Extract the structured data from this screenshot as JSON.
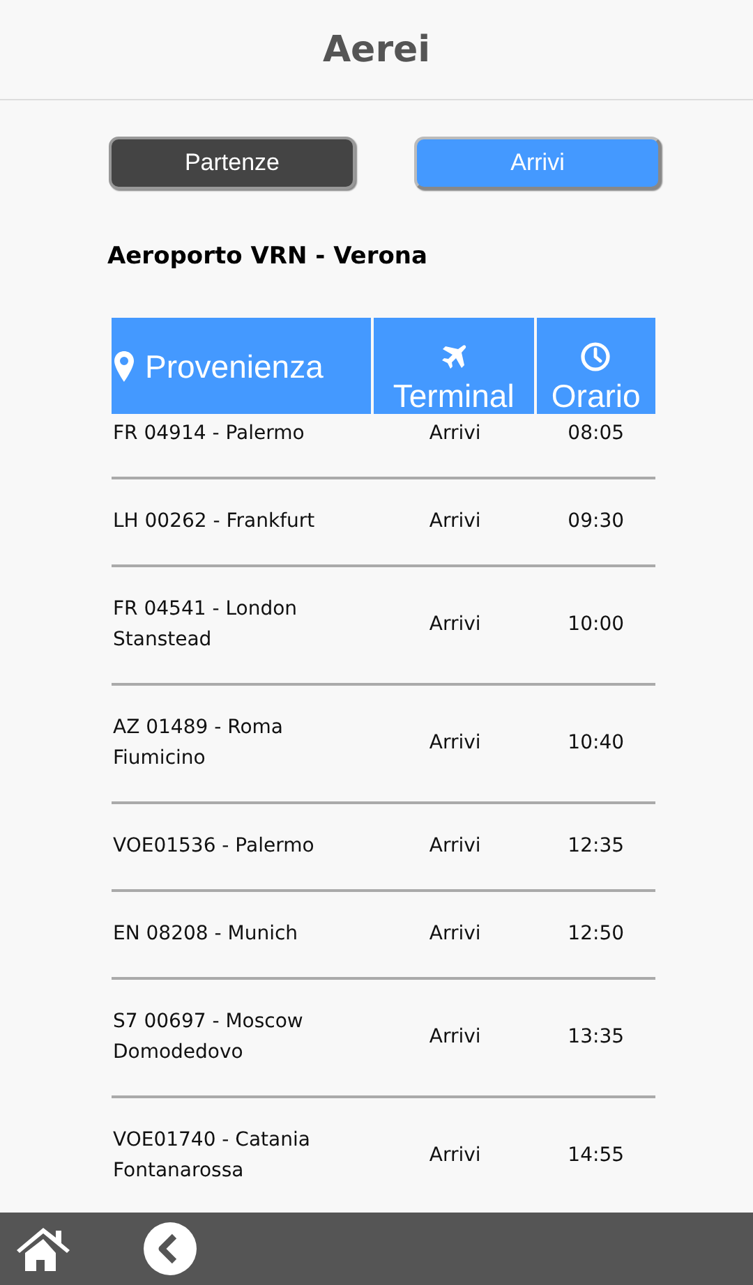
{
  "header": {
    "title": "Aerei"
  },
  "tabs": [
    {
      "label": "Partenze",
      "selected": false
    },
    {
      "label": "Arrivi",
      "selected": true
    }
  ],
  "airport": "Aeroporto VRN - Verona",
  "table": {
    "columns": [
      {
        "label": "Provenienza"
      },
      {
        "label": "Terminal"
      },
      {
        "label": "Orario"
      }
    ],
    "rows": [
      {
        "flight": "FR 04914 - Palermo",
        "terminal": "Arrivi",
        "time": "08:05"
      },
      {
        "flight": "LH 00262 - Frankfurt",
        "terminal": "Arrivi",
        "time": "09:30"
      },
      {
        "flight": "FR 04541 - London Stanstead",
        "terminal": "Arrivi",
        "time": "10:00"
      },
      {
        "flight": "AZ 01489 - Roma Fiumicino",
        "terminal": "Arrivi",
        "time": "10:40"
      },
      {
        "flight": "VOE01536 - Palermo",
        "terminal": "Arrivi",
        "time": "12:35"
      },
      {
        "flight": "EN 08208 - Munich",
        "terminal": "Arrivi",
        "time": "12:50"
      },
      {
        "flight": "S7 00697 - Moscow Domodedovo",
        "terminal": "Arrivi",
        "time": "13:35"
      },
      {
        "flight": "VOE01740 - Catania Fontanarossa",
        "terminal": "Arrivi",
        "time": "14:55"
      }
    ]
  }
}
